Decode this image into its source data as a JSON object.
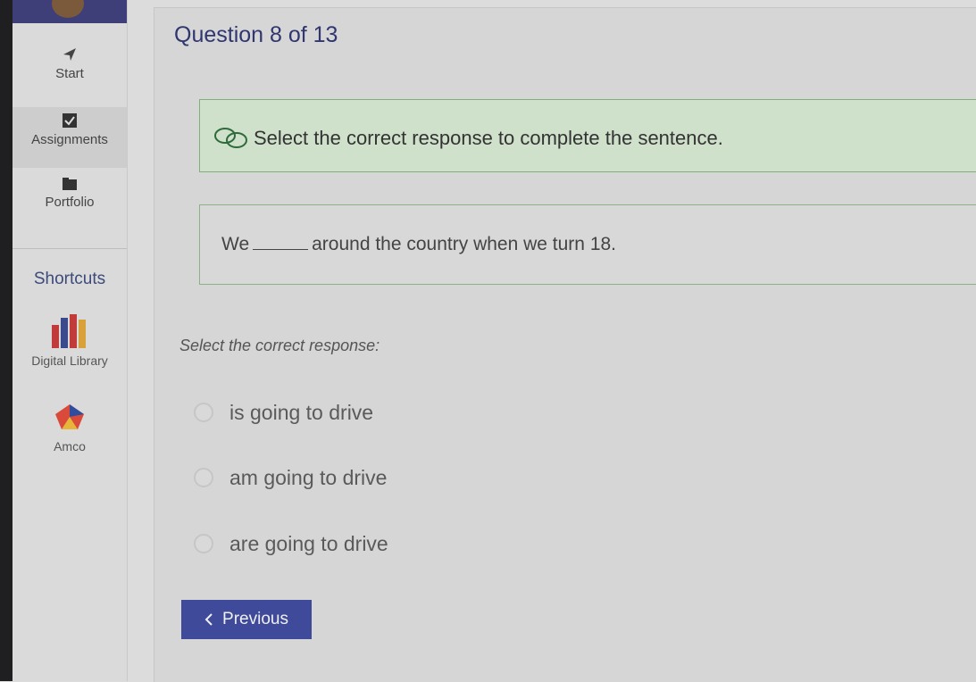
{
  "sidebar": {
    "nav": [
      {
        "label": "Start",
        "icon": "arrow-icon"
      },
      {
        "label": "Assignments",
        "icon": "checkbox-icon"
      },
      {
        "label": "Portfolio",
        "icon": "folder-icon"
      }
    ],
    "shortcuts_title": "Shortcuts",
    "shortcuts": [
      {
        "label": "Digital Library",
        "icon": "books-icon"
      },
      {
        "label": "Amco",
        "icon": "amco-logo-icon"
      }
    ]
  },
  "question": {
    "title": "Question 8 of 13",
    "instruction": "Select the correct response to complete the sentence.",
    "sentence_before": "We",
    "sentence_after": "around the country when we turn 18.",
    "prompt": "Select the correct response:",
    "options": [
      "is going to drive",
      "am going to drive",
      "are going to drive"
    ]
  },
  "buttons": {
    "previous": "Previous"
  },
  "colors": {
    "accent": "#3f4a9a",
    "instruction_bg": "#cfe0cb",
    "sidebar_header": "#3e3e78"
  }
}
